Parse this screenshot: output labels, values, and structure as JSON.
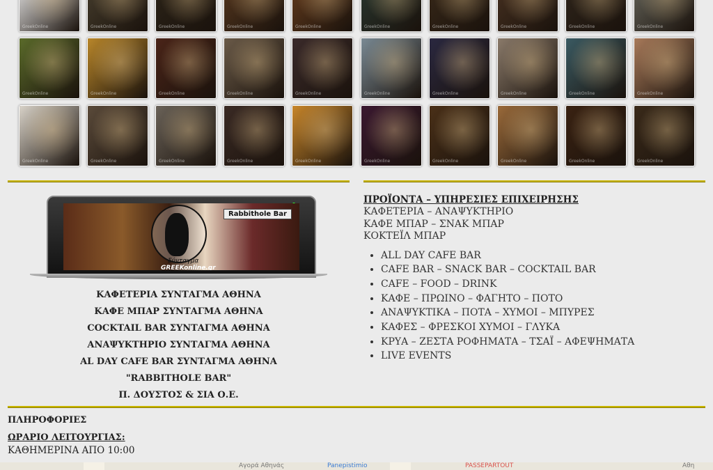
{
  "gallery": {
    "thumb_tag_text": "GreekOnline",
    "rows": [
      [
        {
          "icon": "rabbit-logo-photo",
          "color": "#f4f4f4"
        },
        {
          "icon": "photo",
          "color": "#4a4130"
        },
        {
          "icon": "photo",
          "color": "#2d2519"
        },
        {
          "icon": "photo",
          "color": "#5a3a20"
        },
        {
          "icon": "photo",
          "color": "#6a3f1f"
        },
        {
          "icon": "photo",
          "color": "#2a3a32"
        },
        {
          "icon": "photo",
          "color": "#3a2a1a"
        },
        {
          "icon": "photo",
          "color": "#4a3322"
        },
        {
          "icon": "photo",
          "color": "#30261c"
        },
        {
          "icon": "photo",
          "color": "#6a6a60"
        }
      ],
      [
        {
          "icon": "photo",
          "color": "#5a6a2a"
        },
        {
          "icon": "photo",
          "color": "#b8862a"
        },
        {
          "icon": "photo",
          "color": "#4a2418"
        },
        {
          "icon": "photo",
          "color": "#6a5a48"
        },
        {
          "icon": "photo",
          "color": "#3a2a2a"
        },
        {
          "icon": "photo",
          "color": "#7a8a94"
        },
        {
          "icon": "photo",
          "color": "#2a2840"
        },
        {
          "icon": "photo",
          "color": "#8a7a6a"
        },
        {
          "icon": "photo",
          "color": "#3a5a62"
        },
        {
          "icon": "photo",
          "color": "#a87a5a"
        }
      ],
      [
        {
          "icon": "photo",
          "color": "#d8d2c8"
        },
        {
          "icon": "photo",
          "color": "#5a4a3a"
        },
        {
          "icon": "photo",
          "color": "#6a6258"
        },
        {
          "icon": "photo",
          "color": "#3a2a24"
        },
        {
          "icon": "photo",
          "color": "#c8862a"
        },
        {
          "icon": "photo",
          "color": "#3a1830"
        },
        {
          "icon": "photo",
          "color": "#4a3018"
        },
        {
          "icon": "photo",
          "color": "#9a6a3a"
        },
        {
          "icon": "photo",
          "color": "#3a2212"
        },
        {
          "icon": "photo",
          "color": "#3a2a1a"
        }
      ]
    ]
  },
  "laptop": {
    "brand": "Rabbithole Bar",
    "city": "Σύνταγμα",
    "site": "GREEKonline.gr"
  },
  "left_lines": [
    "ΚΑΦΕΤΕΡΙΑ ΣΥΝΤΑΓΜΑ ΑΘΗΝΑ",
    "ΚΑΦΕ ΜΠΑΡ ΣΥΝΤΑΓΜΑ ΑΘΗΝΑ",
    "COCKTAIL BAR ΣΥΝΤΑΓΜΑ ΑΘΗΝΑ",
    "ΑΝΑΨΥΚΤΗΡΙΟ ΣΥΝΤΑΓΜΑ ΑΘΗΝΑ",
    "AL DAY CAFE BAR ΣΥΝΤΑΓΜΑ ΑΘΗΝΑ",
    "\"RABBITHOLE BAR\"",
    "Π. ΔΟΥΣΤΟΣ & ΣΙΑ Ο.Ε."
  ],
  "right": {
    "heading": "ΠΡΟΪΟΝΤΑ – ΥΠΗΡΕΣΙΕΣ ΕΠΙΧΕΙΡΗΣΗΣ",
    "lines": [
      "ΚΑΦΕΤΕΡΙΑ – ΑΝΑΨΥΚΤΗΡΙΟ",
      "ΚΑΦΕ ΜΠΑΡ – ΣΝΑΚ ΜΠΑΡ",
      "ΚΟΚΤΕΪΛ ΜΠΑΡ"
    ],
    "items": [
      "ALL DAY CAFE BAR",
      "CAFE BAR – SNACK BAR – COCKTAIL BAR",
      "CAFE – FOOD – DRINK",
      "ΚΑΦΕ – ΠΡΩΙΝΟ – ΦΑΓΗΤΟ – ΠΟΤΟ",
      "ΑΝΑΨΥΚΤΙΚΑ – ΠΟΤΑ – ΧΥΜΟΙ – ΜΠΥΡΕΣ",
      "ΚΑΦΕΣ – ΦΡΕΣΚΟΙ ΧΥΜΟΙ – ΓΛΥΚΑ",
      "ΚΡΥΑ – ΖΕΣΤΑ ΡΟΦΗΜΑΤΑ – ΤΣΑΪ – ΑΦΕΨΗΜΑΤΑ",
      "LIVE EVENTS"
    ]
  },
  "info": {
    "title": "ΠΛΗΡΟΦΟΡΙΕΣ",
    "hours_label": "ΩΡΑΡΙΟ ΛΕΙΤΟΥΡΓΙΑΣ:",
    "hours_value": "ΚΑΘΗΜΕΡΙΝΑ ΑΠΟ 10:00"
  },
  "map": {
    "labels": [
      "Αγορά Αθηνάς",
      "Panepistimio",
      "PASSEPARTOUT",
      "Αθη"
    ]
  },
  "colors": {
    "separator": "#c8b400",
    "page_bg": "#ebebeb",
    "map_label_accent": "#d9534f"
  }
}
